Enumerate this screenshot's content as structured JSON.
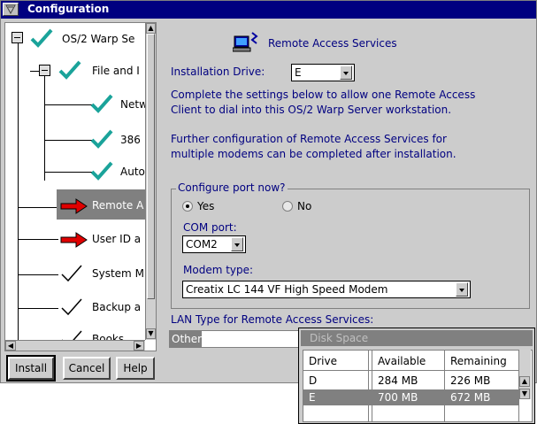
{
  "window": {
    "title": "Configuration"
  },
  "tree": {
    "items": [
      {
        "label": "OS/2 Warp Se",
        "icon": "teal-check-icon"
      },
      {
        "label": "File and I",
        "icon": "teal-check-icon"
      },
      {
        "label": "Netw",
        "icon": "teal-check-icon"
      },
      {
        "label": "386",
        "icon": "teal-check-icon"
      },
      {
        "label": "Auto",
        "icon": "teal-check-icon"
      },
      {
        "label": "Remote A",
        "icon": "red-arrow-icon"
      },
      {
        "label": "User ID a",
        "icon": "red-arrow-icon"
      },
      {
        "label": "System M",
        "icon": "outline-check-icon"
      },
      {
        "label": "Backup a",
        "icon": "outline-check-icon"
      },
      {
        "label": "Books",
        "icon": "outline-check-icon"
      }
    ]
  },
  "buttons": {
    "install": "Install",
    "cancel": "Cancel",
    "help": "Help"
  },
  "main": {
    "header": "Remote Access Services",
    "install_drive_label": "Installation Drive:",
    "install_drive_value": "E",
    "desc1_line1": "Complete the settings below to allow one Remote Access",
    "desc1_line2": "Client to dial into this OS/2 Warp Server workstation.",
    "desc2_line1": "Further configuration of Remote Access Services for",
    "desc2_line2": "multiple modems can be completed after installation.",
    "configure_group": "Configure port now?",
    "yes_label": "Yes",
    "no_label": "No",
    "com_port_label": "COM port:",
    "com_port_value": "COM2",
    "modem_type_label": "Modem type:",
    "modem_type_value": "Creatix LC 144 VF High Speed Modem",
    "lan_type_label": "LAN Type for Remote Access Services:",
    "lan_type_value": "Other"
  },
  "disk_space": {
    "title": "Disk Space",
    "columns": [
      "Drive",
      "Available",
      "Remaining"
    ],
    "rows": [
      [
        "D",
        "284 MB",
        "226 MB"
      ],
      [
        "E",
        "700 MB",
        "672 MB"
      ]
    ]
  },
  "colors": {
    "title_bar": "#000080",
    "text_blue": "#000080",
    "teal_check": "#1aa39a",
    "red_arrow": "#e00000"
  }
}
